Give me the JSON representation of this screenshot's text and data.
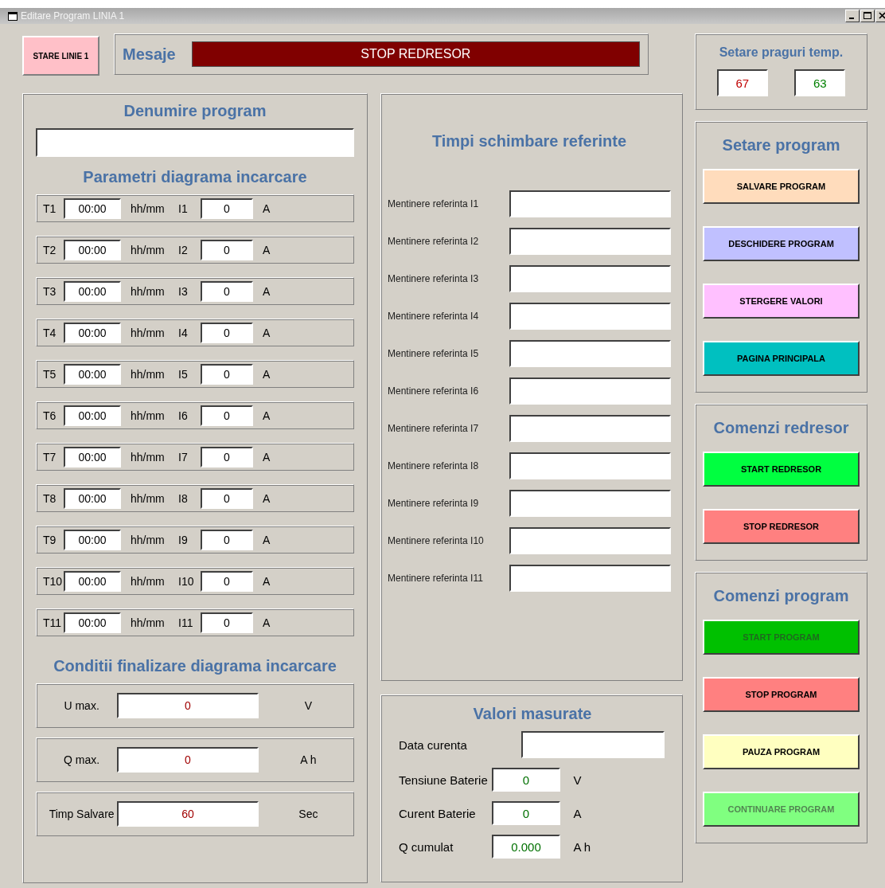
{
  "window": {
    "title": "Editare Program LINIA 1"
  },
  "status_button": {
    "label": "STARE LINIE 1"
  },
  "messages": {
    "label": "Mesaje",
    "text": "STOP REDRESOR"
  },
  "program_name": {
    "heading": "Denumire program"
  },
  "parameters": {
    "heading": "Parametri diagrama incarcare",
    "rows": [
      {
        "time_label": "T1",
        "time": "00:00",
        "time_unit": "hh/mm",
        "current_label": "I1",
        "current": "0",
        "current_unit": "A"
      },
      {
        "time_label": "T2",
        "time": "00:00",
        "time_unit": "hh/mm",
        "current_label": "I2",
        "current": "0",
        "current_unit": "A"
      },
      {
        "time_label": "T3",
        "time": "00:00",
        "time_unit": "hh/mm",
        "current_label": "I3",
        "current": "0",
        "current_unit": "A"
      },
      {
        "time_label": "T4",
        "time": "00:00",
        "time_unit": "hh/mm",
        "current_label": "I4",
        "current": "0",
        "current_unit": "A"
      },
      {
        "time_label": "T5",
        "time": "00:00",
        "time_unit": "hh/mm",
        "current_label": "I5",
        "current": "0",
        "current_unit": "A"
      },
      {
        "time_label": "T6",
        "time": "00:00",
        "time_unit": "hh/mm",
        "current_label": "I6",
        "current": "0",
        "current_unit": "A"
      },
      {
        "time_label": "T7",
        "time": "00:00",
        "time_unit": "hh/mm",
        "current_label": "I7",
        "current": "0",
        "current_unit": "A"
      },
      {
        "time_label": "T8",
        "time": "00:00",
        "time_unit": "hh/mm",
        "current_label": "I8",
        "current": "0",
        "current_unit": "A"
      },
      {
        "time_label": "T9",
        "time": "00:00",
        "time_unit": "hh/mm",
        "current_label": "I9",
        "current": "0",
        "current_unit": "A"
      },
      {
        "time_label": "T10",
        "time": "00:00",
        "time_unit": "hh/mm",
        "current_label": "I10",
        "current": "0",
        "current_unit": "A"
      },
      {
        "time_label": "T11",
        "time": "00:00",
        "time_unit": "hh/mm",
        "current_label": "I11",
        "current": "0",
        "current_unit": "A"
      }
    ]
  },
  "end_conditions": {
    "heading": "Conditii finalizare diagrama incarcare",
    "rows": [
      {
        "label": "U max.",
        "value": "0",
        "unit": "V"
      },
      {
        "label": "Q max.",
        "value": "0",
        "unit": "A h"
      },
      {
        "label": "Timp Salvare",
        "value": "60",
        "unit": "Sec"
      }
    ]
  },
  "reference_times": {
    "heading": "Timpi schimbare referinte",
    "rows": [
      {
        "label": "Mentinere referinta I1"
      },
      {
        "label": "Mentinere referinta I2"
      },
      {
        "label": "Mentinere referinta I3"
      },
      {
        "label": "Mentinere referinta I4"
      },
      {
        "label": "Mentinere referinta I5"
      },
      {
        "label": "Mentinere referinta I6"
      },
      {
        "label": "Mentinere referinta I7"
      },
      {
        "label": "Mentinere referinta I8"
      },
      {
        "label": "Mentinere referinta I9"
      },
      {
        "label": "Mentinere referinta I10"
      },
      {
        "label": "Mentinere referinta I11"
      }
    ]
  },
  "measured": {
    "heading": "Valori masurate",
    "rows": [
      {
        "kind": "text",
        "label": "Data curenta"
      },
      {
        "kind": "reading",
        "label": "Tensiune Baterie",
        "value": "0",
        "unit": "V"
      },
      {
        "kind": "reading",
        "label": "Curent Baterie",
        "value": "0",
        "unit": "A"
      },
      {
        "kind": "reading",
        "label": "Q cumulat",
        "value": "0.000",
        "unit": "A h"
      }
    ]
  },
  "temperature_thresholds": {
    "heading": "Setare praguri temp.",
    "fields": [
      {
        "value": "67",
        "color": "#c00000"
      },
      {
        "value": "63",
        "color": "#008000"
      }
    ]
  },
  "command_panels": [
    {
      "heading": "Setare program",
      "buttons": [
        {
          "label": "SALVARE PROGRAM",
          "color": "#ffdcbc",
          "disabled": false
        },
        {
          "label": "DESCHIDERE PROGRAM",
          "color": "#c0c0ff",
          "disabled": false
        },
        {
          "label": "STERGERE VALORI",
          "color": "#ffc0ff",
          "disabled": false
        },
        {
          "label": "PAGINA PRINCIPALA",
          "color": "#00c0c0",
          "disabled": false
        }
      ]
    },
    {
      "heading": "Comenzi redresor",
      "buttons": [
        {
          "label": "START REDRESOR",
          "color": "#00ff40",
          "disabled": false
        },
        {
          "label": "STOP REDRESOR",
          "color": "#ff8080",
          "disabled": false
        }
      ]
    },
    {
      "heading": "Comenzi program",
      "buttons": [
        {
          "label": "START PROGRAM",
          "color": "#00c000",
          "disabled": true
        },
        {
          "label": "STOP PROGRAM",
          "color": "#ff8080",
          "disabled": false
        },
        {
          "label": "PAUZA PROGRAM",
          "color": "#ffffc0",
          "disabled": false
        },
        {
          "label": "CONTINUARE PROGRAM",
          "color": "#80ff80",
          "disabled": true
        }
      ]
    }
  ]
}
